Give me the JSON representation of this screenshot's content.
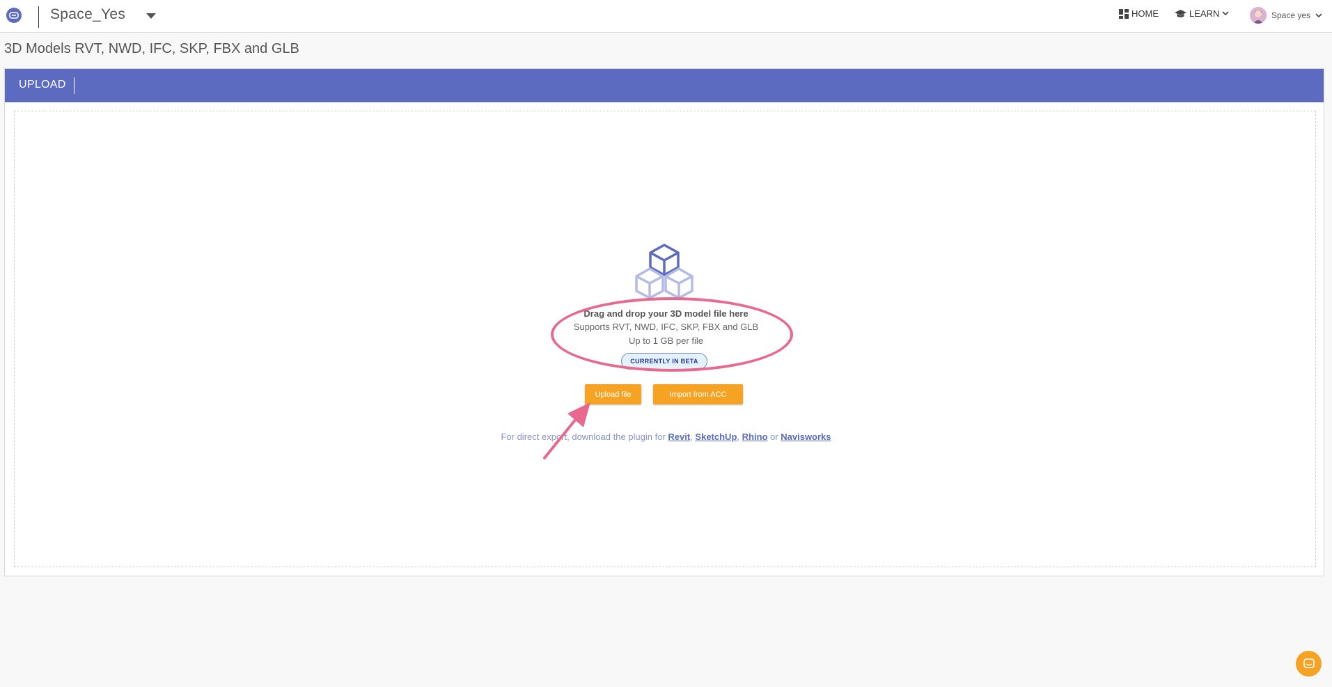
{
  "header": {
    "logo_icon": "viewer-logo-icon",
    "project_name": "Space_Yes",
    "nav": {
      "home_label": "HOME",
      "learn_label": "LEARN",
      "user_name": "Space yes"
    }
  },
  "page": {
    "title": "3D Models RVT, NWD, IFC, SKP, FBX and GLB"
  },
  "tabs": [
    {
      "label": "UPLOAD",
      "active": true
    }
  ],
  "dropzone": {
    "icon": "stacked-cubes-icon",
    "title": "Drag and drop your 3D model file here",
    "formats": "Supports RVT, NWD, IFC, SKP, FBX and GLB",
    "limit": "Up to 1 GB per file",
    "badge": "CURRENTLY IN BETA",
    "upload_button": "Upload file",
    "import_button": "Import from ACC",
    "plugin_prefix": "For direct export, download the plugin for ",
    "plugins": [
      "Revit",
      "SketchUp",
      "Rhino",
      "Navisworks"
    ],
    "sep_comma": ", ",
    "sep_or": " or "
  },
  "colors": {
    "accent": "#5c6bc0",
    "button": "#f6a323",
    "annotation": "#e8688e",
    "badge_bg": "#e3f2fd"
  }
}
